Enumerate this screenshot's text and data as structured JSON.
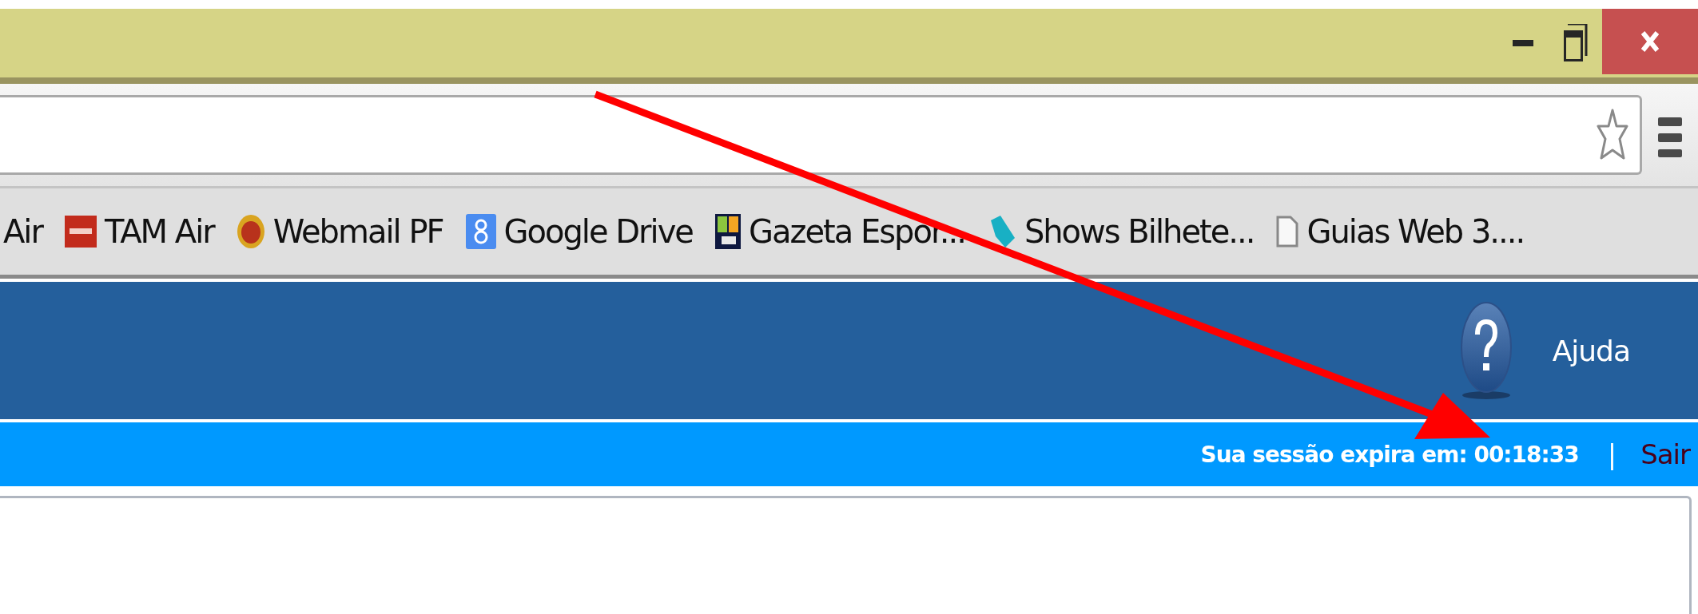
{
  "bookmarks": [
    {
      "label": "Air",
      "kind": "plain"
    },
    {
      "label": "TAM Air",
      "kind": "tam"
    },
    {
      "label": "Webmail PF",
      "kind": "webmail"
    },
    {
      "label": "Google Drive",
      "kind": "drive"
    },
    {
      "label": "Gazeta Espor...",
      "kind": "ge"
    },
    {
      "label": "Shows Bilhete...",
      "kind": "ticket"
    },
    {
      "label": "Guias Web 3....",
      "kind": "page"
    }
  ],
  "header": {
    "help_label": "Ajuda"
  },
  "session_bar": {
    "text": "Sua sessão expira em: 00:18:33",
    "separator": "|",
    "logout": "Sair"
  }
}
